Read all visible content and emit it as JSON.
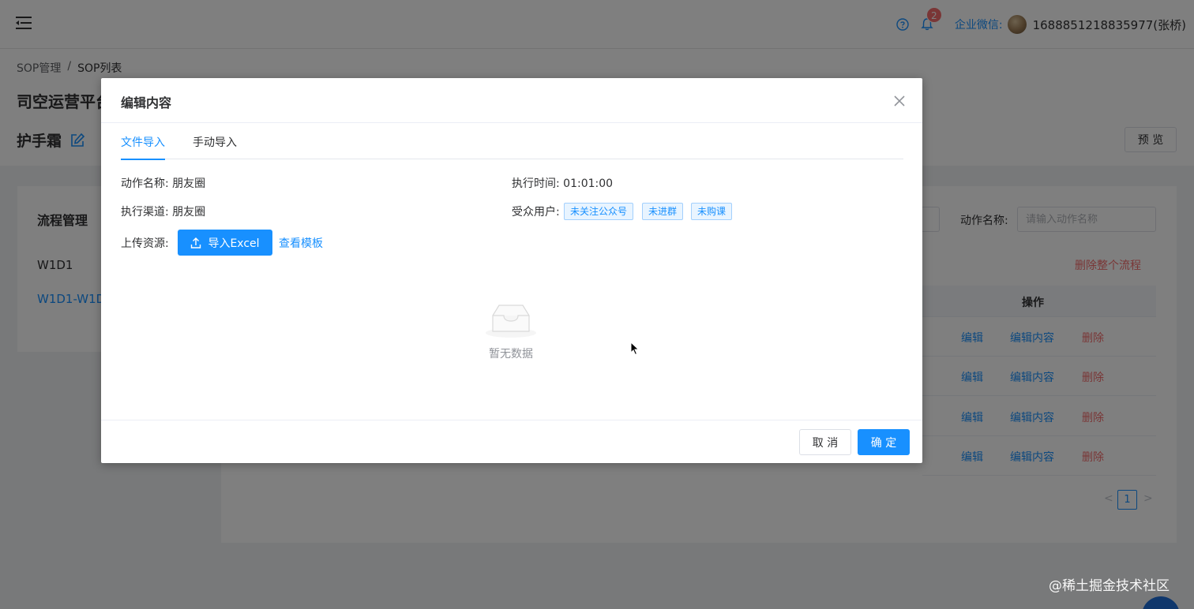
{
  "topbar": {
    "notification_count": "2",
    "wecom_label": "企业微信:",
    "user_name": "1688851218835977(张桥)"
  },
  "breadcrumb": {
    "root": "SOP管理",
    "separator": "/",
    "current": "SOP列表"
  },
  "page": {
    "title": "司空运营平台",
    "subtitle": "护手霜",
    "preview_label": "预 览"
  },
  "flow": {
    "title": "流程管理",
    "items": [
      "W1D1",
      "W1D1-W1D"
    ]
  },
  "main": {
    "search_label": "动作名称:",
    "search_placeholder": "请输入动作名称",
    "delete_flow_label": "删除整个流程",
    "op_header": "操作",
    "row_actions": {
      "edit": "编辑",
      "edit_content": "编辑内容",
      "delete": "删除"
    },
    "pager": {
      "current": "1",
      "prev": "<",
      "next": ">"
    }
  },
  "watermark": "@稀土掘金技术社区",
  "dialog": {
    "title": "编辑内容",
    "tabs": [
      "文件导入",
      "手动导入"
    ],
    "active_tab": 0,
    "action_name": "动作名称: 朋友圈",
    "exec_time": "执行时间: 01:01:00",
    "channel": "执行渠道: 朋友圈",
    "audience_label": "受众用户:",
    "audience_tags": [
      "未关注公众号",
      "未进群",
      "未购课"
    ],
    "upload_label": "上传资源:",
    "import_button": "导入Excel",
    "template_link": "查看模板",
    "empty_text": "暂无数据",
    "cancel_label": "取 消",
    "ok_label": "确 定"
  },
  "colors": {
    "primary": "#1890ff",
    "danger": "#f56c6c",
    "text": "#303133",
    "muted": "#909399"
  }
}
